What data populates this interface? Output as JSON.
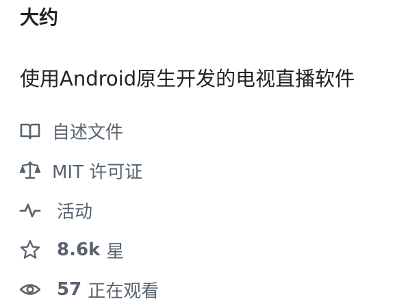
{
  "about": {
    "heading": "大约",
    "description": "使用Android原生开发的电视直播软件"
  },
  "links": {
    "readme": {
      "icon": "book-icon",
      "label": "自述文件"
    },
    "license": {
      "icon": "law-icon",
      "label": "MIT 许可证"
    },
    "activity": {
      "icon": "pulse-icon",
      "label": "活动"
    },
    "stars": {
      "icon": "star-icon",
      "count": "8.6k",
      "label": "星"
    },
    "watchers": {
      "icon": "eye-icon",
      "count": "57",
      "label": "正在观看"
    }
  },
  "colors": {
    "text": "#1f2328",
    "muted": "#59636e",
    "background": "#ffffff"
  }
}
